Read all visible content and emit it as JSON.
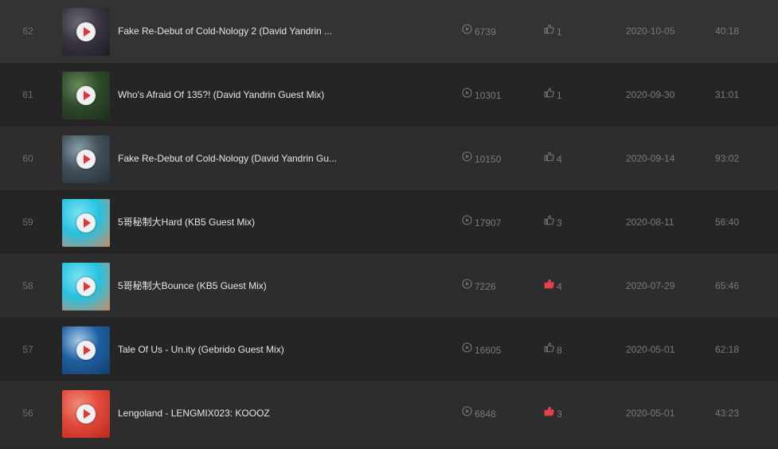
{
  "tracks": [
    {
      "num": "62",
      "title": "Fake Re-Debut of Cold-Nology 2 (David Yandrin ...",
      "plays": "6739",
      "likes": "1",
      "liked": false,
      "date": "2020-10-05",
      "duration": "40:18",
      "cover": [
        "#3a3540",
        "#6b6a78",
        "#1e1c24"
      ]
    },
    {
      "num": "61",
      "title": "Who's Afraid Of 135?! (David Yandrin Guest Mix)",
      "plays": "10301",
      "likes": "1",
      "liked": false,
      "date": "2020-09-30",
      "duration": "31:01",
      "cover": [
        "#2e4a2c",
        "#6a8c5a",
        "#1d2e1b"
      ]
    },
    {
      "num": "60",
      "title": "Fake Re-Debut of Cold-Nology (David Yandrin Gu...",
      "plays": "10150",
      "likes": "4",
      "liked": false,
      "date": "2020-09-14",
      "duration": "93:02",
      "cover": [
        "#41505a",
        "#8aa0ad",
        "#26313a"
      ]
    },
    {
      "num": "59",
      "title": "5哥秘制大Hard (KB5 Guest Mix)",
      "plays": "17907",
      "likes": "3",
      "liked": false,
      "date": "2020-08-11",
      "duration": "56:40",
      "cover": [
        "#25c3e0",
        "#7de2f2",
        "#c98a6a"
      ]
    },
    {
      "num": "58",
      "title": "5哥秘制大Bounce (KB5 Guest Mix)",
      "plays": "7226",
      "likes": "4",
      "liked": true,
      "date": "2020-07-29",
      "duration": "65:46",
      "cover": [
        "#25c3e0",
        "#7de2f2",
        "#c98a6a"
      ]
    },
    {
      "num": "57",
      "title": "Tale Of Us - Un.ity (Gebrido Guest Mix)",
      "plays": "16605",
      "likes": "8",
      "liked": false,
      "date": "2020-05-01",
      "duration": "62:18",
      "cover": [
        "#1f5fa0",
        "#a8cde8",
        "#163e6a"
      ]
    },
    {
      "num": "56",
      "title": "Lengoland - LENGMIX023: KOOOZ",
      "plays": "6848",
      "likes": "3",
      "liked": true,
      "date": "2020-05-01",
      "duration": "43:23",
      "cover": [
        "#e14a3c",
        "#f08a78",
        "#b8281c"
      ]
    }
  ],
  "colors": {
    "accent": "#e0363a",
    "liked": "#e8414a",
    "icon": "#7a7a7a"
  },
  "icons": {
    "plays": "play-circle-icon",
    "likes": "thumbs-up-icon",
    "cover": "play-button-icon"
  }
}
